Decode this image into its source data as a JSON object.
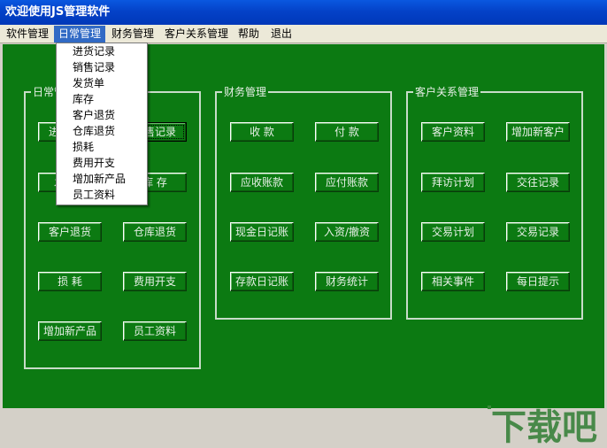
{
  "window": {
    "title": "欢迎使用JS管理软件"
  },
  "menubar": {
    "items": [
      {
        "label": "软件管理"
      },
      {
        "label": "日常管理"
      },
      {
        "label": "财务管理"
      },
      {
        "label": "客户关系管理"
      },
      {
        "label": "帮助"
      },
      {
        "label": "退出"
      }
    ]
  },
  "dropdown": {
    "items": [
      "进货记录",
      "销售记录",
      "发货单",
      "库存",
      "客户退货",
      "仓库退货",
      "损耗",
      "费用开支",
      "增加新产品",
      "员工资料"
    ]
  },
  "daily": {
    "title": "日常管理",
    "buttons": [
      "进货记录",
      "销售记录",
      "发货单",
      "库 存",
      "客户退货",
      "仓库退货",
      "损 耗",
      "费用开支",
      "增加新产品",
      "员工资料"
    ]
  },
  "finance": {
    "title": "财务管理",
    "buttons": [
      "收 款",
      "付 款",
      "应收账款",
      "应付账款",
      "现金日记账",
      "入资/撤资",
      "存款日记账",
      "财务统计"
    ]
  },
  "crm": {
    "title": "客户关系管理",
    "buttons": [
      "客户资料",
      "增加新客户",
      "拜访计划",
      "交往记录",
      "交易计划",
      "交易记录",
      "相关事件",
      "每日提示"
    ]
  },
  "watermark": {
    "text": "下载吧"
  },
  "colors": {
    "background": "#0c7a12",
    "titlebar": "#0442c8",
    "menu_highlight": "#316ac5"
  }
}
